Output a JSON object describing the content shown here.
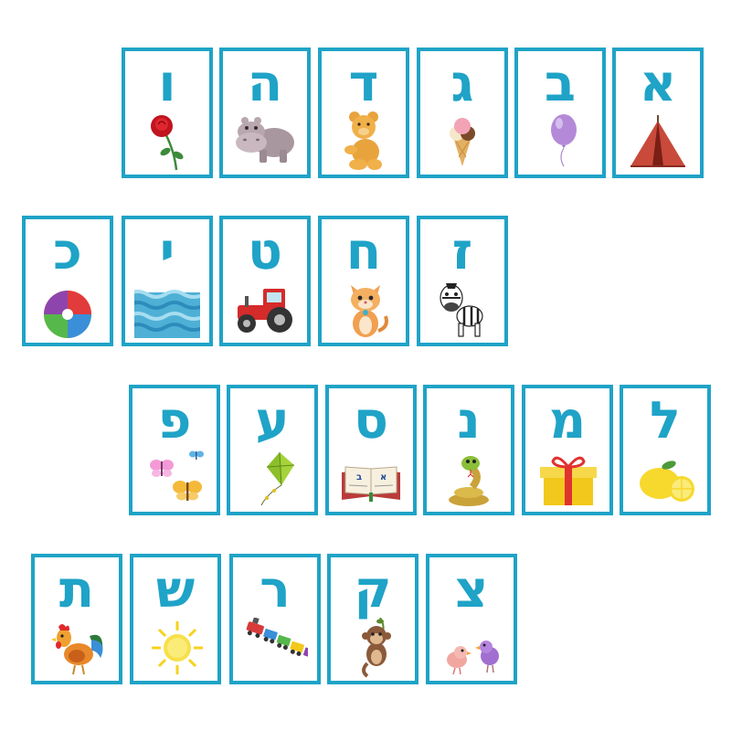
{
  "colors": {
    "card_border": "#1fa3c7",
    "letter": "#1fa3c7",
    "background": "#ffffff"
  },
  "rows": [
    {
      "cards": [
        {
          "letter": "א",
          "icon": "tent-icon"
        },
        {
          "letter": "ב",
          "icon": "balloon-icon"
        },
        {
          "letter": "ג",
          "icon": "ice-cream-icon"
        },
        {
          "letter": "ד",
          "icon": "teddy-bear-icon"
        },
        {
          "letter": "ה",
          "icon": "hippo-icon"
        },
        {
          "letter": "ו",
          "icon": "rose-icon"
        }
      ]
    },
    {
      "cards": [
        {
          "letter": "ז",
          "icon": "zebra-icon"
        },
        {
          "letter": "ח",
          "icon": "cat-icon"
        },
        {
          "letter": "ט",
          "icon": "tractor-icon"
        },
        {
          "letter": "י",
          "icon": "sea-icon"
        },
        {
          "letter": "כ",
          "icon": "ball-icon"
        }
      ]
    },
    {
      "cards": [
        {
          "letter": "ל",
          "icon": "lemon-icon"
        },
        {
          "letter": "מ",
          "icon": "gift-icon"
        },
        {
          "letter": "נ",
          "icon": "snake-icon"
        },
        {
          "letter": "ס",
          "icon": "book-icon"
        },
        {
          "letter": "ע",
          "icon": "kite-icon"
        },
        {
          "letter": "פ",
          "icon": "butterflies-icon"
        }
      ]
    },
    {
      "cards": [
        {
          "letter": "צ",
          "icon": "birds-icon"
        },
        {
          "letter": "ק",
          "icon": "monkey-icon"
        },
        {
          "letter": "ר",
          "icon": "train-icon"
        },
        {
          "letter": "ש",
          "icon": "sun-icon"
        },
        {
          "letter": "ת",
          "icon": "rooster-icon"
        }
      ]
    }
  ]
}
